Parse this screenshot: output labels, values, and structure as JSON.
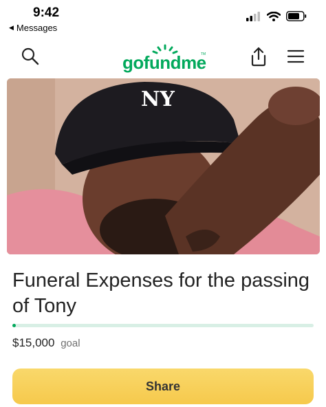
{
  "status_bar": {
    "time": "9:42",
    "back_label": "Messages",
    "icons": [
      "cellular-signal-icon",
      "wifi-icon",
      "battery-icon"
    ]
  },
  "header": {
    "logo_text": "gofundme",
    "icons": [
      "search-icon",
      "share-icon",
      "menu-icon"
    ],
    "brand_color": "#02a95c"
  },
  "campaign": {
    "title": "Funeral Expenses for the passing of Tony",
    "goal_amount": "$15,000",
    "goal_label": "goal",
    "progress_fraction": 0.01,
    "share_label": "Share",
    "share_button_color": "#f7cd55"
  }
}
